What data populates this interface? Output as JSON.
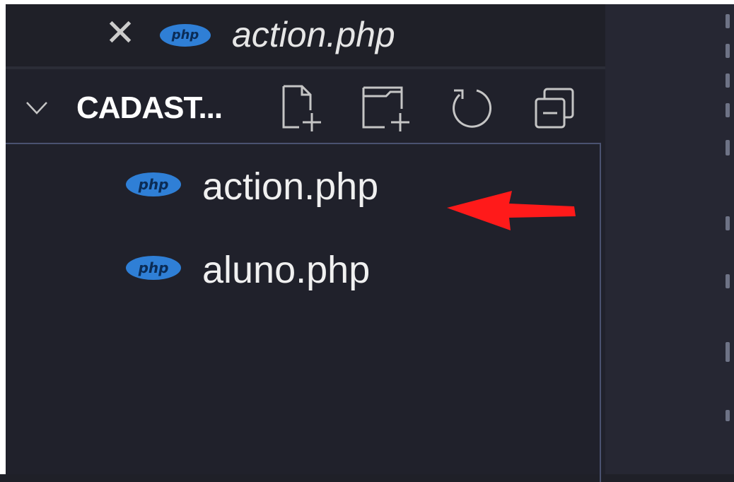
{
  "open_editors": {
    "items": [
      {
        "file": "action.php",
        "icon": "php-file-icon",
        "close_glyph": "✕",
        "italic": true
      }
    ]
  },
  "explorer": {
    "folder_name": "CADAST...",
    "expanded": true,
    "actions": [
      {
        "name": "new-file-icon",
        "label": "New File"
      },
      {
        "name": "new-folder-icon",
        "label": "New Folder"
      },
      {
        "name": "refresh-icon",
        "label": "Refresh Explorer"
      },
      {
        "name": "collapse-all-icon",
        "label": "Collapse Folders in Explorer"
      }
    ],
    "files": [
      {
        "name": "action.php",
        "icon": "php-file-icon",
        "badge": "php"
      },
      {
        "name": "aluno.php",
        "icon": "php-file-icon",
        "badge": "php"
      }
    ]
  },
  "annotation": {
    "type": "red-arrow",
    "points_to": "action.php",
    "color": "#ff1a1a"
  },
  "colors": {
    "background": "#20212b",
    "php_badge": "#2f7fd6",
    "border": "#4a5270"
  }
}
